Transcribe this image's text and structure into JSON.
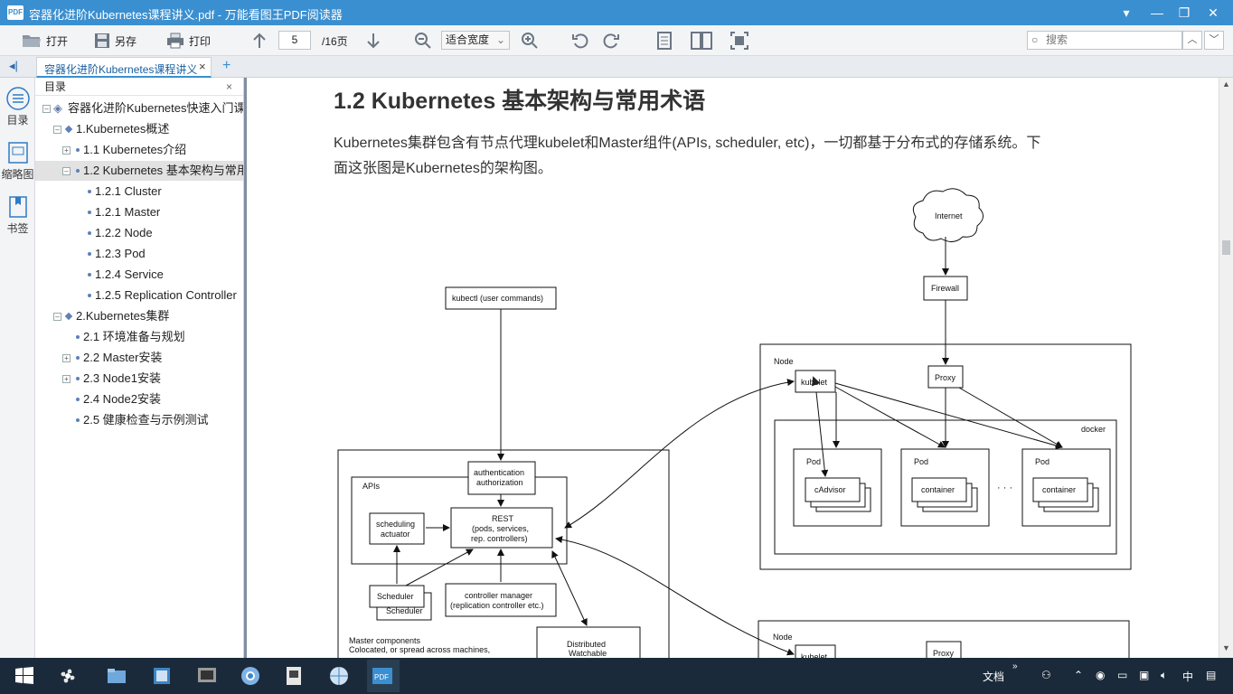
{
  "window": {
    "app_icon_text": "PDF",
    "title": "容器化进阶Kubernetes课程讲义.pdf - 万能看图王PDF阅读器"
  },
  "toolbar": {
    "open": "打开",
    "save_as": "另存",
    "print": "打印",
    "page_current": "5",
    "page_total": "/16页",
    "zoom_mode": "适合宽度",
    "search_placeholder": "搜索"
  },
  "tab": {
    "label": "容器化进阶Kubernetes课程讲义",
    "close": "×",
    "add": "+"
  },
  "rail": {
    "toc": "目录",
    "thumbs": "缩略图",
    "bookmarks": "书签"
  },
  "toc": {
    "header": "目录",
    "close": "×",
    "items": [
      {
        "label": "容器化进阶Kubernetes快速入门课"
      },
      {
        "label": "1.Kubernetes概述"
      },
      {
        "label": "1.1 Kubernetes介绍"
      },
      {
        "label": "1.2 Kubernetes 基本架构与常用术语"
      },
      {
        "label": "1.2.1 Cluster"
      },
      {
        "label": "1.2.1 Master"
      },
      {
        "label": "1.2.2 Node"
      },
      {
        "label": "1.2.3 Pod"
      },
      {
        "label": "1.2.4 Service"
      },
      {
        "label": "1.2.5 Replication Controller"
      },
      {
        "label": "2.Kubernetes集群"
      },
      {
        "label": "2.1 环境准备与规划"
      },
      {
        "label": "2.2 Master安装"
      },
      {
        "label": "2.3 Node1安装"
      },
      {
        "label": "2.4 Node2安装"
      },
      {
        "label": "2.5 健康检查与示例测试"
      }
    ]
  },
  "document": {
    "heading": "1.2 Kubernetes 基本架构与常用术语",
    "para_line1": "Kubernetes集群包含有节点代理kubelet和Master组件(APIs, scheduler, etc)，一切都基于分布式的存储系统。下",
    "para_line2": "面这张图是Kubernetes的架构图。"
  },
  "diagram": {
    "internet": "Internet",
    "firewall": "Firewall",
    "kubectl": "kubectl (user commands)",
    "node": "Node",
    "kubelet": "kubelet",
    "proxy": "Proxy",
    "docker": "docker",
    "pod": "Pod",
    "cadvisor": "cAdvisor",
    "container": "container",
    "ellipsis": "· · ·",
    "auth1": "authentication",
    "auth2": "authorization",
    "apis": "APIs",
    "rest1": "REST",
    "rest2": "(pods, services,",
    "rest3": "rep. controllers)",
    "sched_act1": "scheduling",
    "sched_act2": "actuator",
    "scheduler": "Scheduler",
    "ctrl1": "controller manager",
    "ctrl2": "(replication controller etc.)",
    "master1": "Master components",
    "master2": "Colocated, or spread across machines,",
    "dist1": "Distributed",
    "dist2": "Watchable"
  },
  "taskbar": {
    "docs_label": "文档",
    "ime": "中",
    "colors": {
      "bar": "#1b2a3a",
      "accent": "#3a8fd0"
    }
  }
}
